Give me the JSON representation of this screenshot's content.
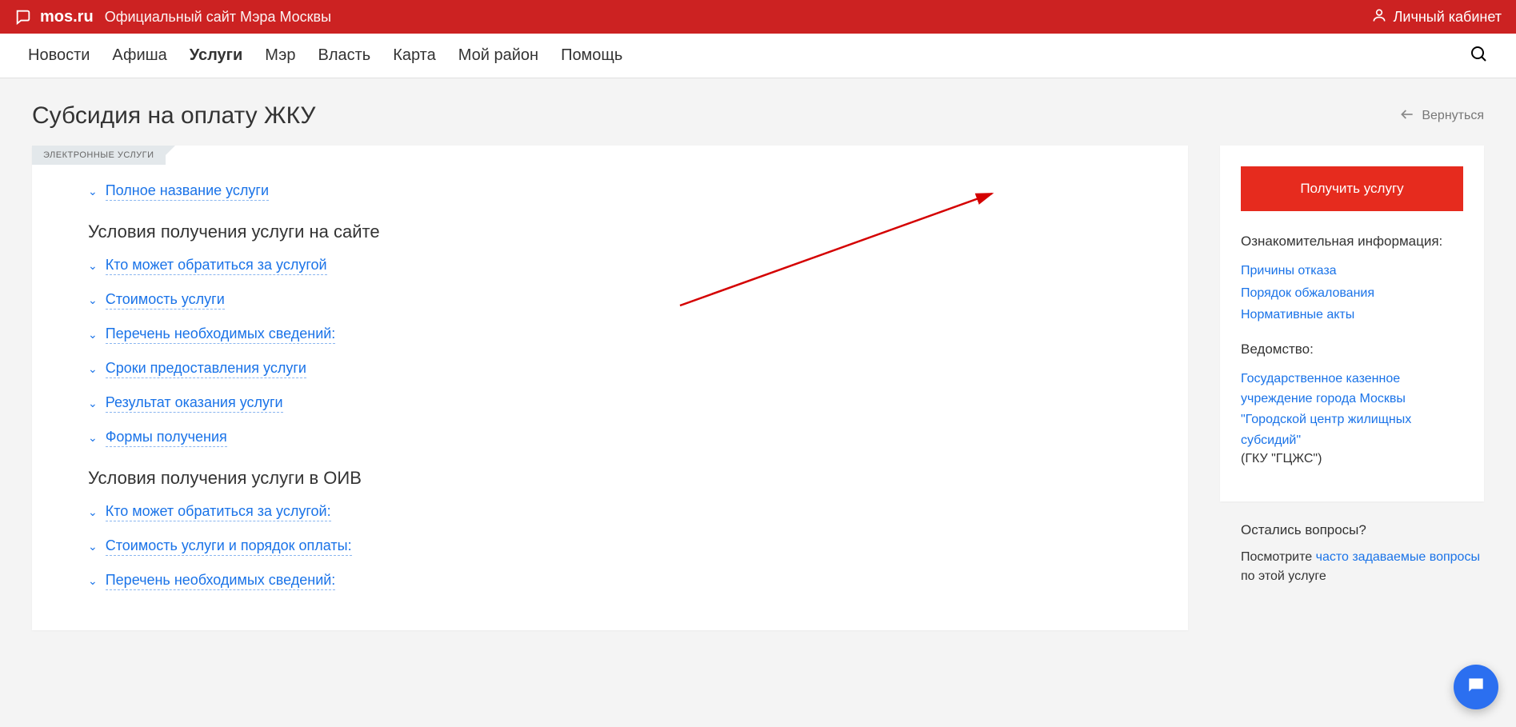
{
  "topbar": {
    "sitename": "mos.ru",
    "sitedesc": "Официальный сайт Мэра Москвы",
    "account": "Личный кабинет"
  },
  "nav": {
    "items": [
      "Новости",
      "Афиша",
      "Услуги",
      "Мэр",
      "Власть",
      "Карта",
      "Мой район",
      "Помощь"
    ],
    "active_index": 2
  },
  "page": {
    "title": "Субсидия на оплату ЖКУ",
    "back_label": "Вернуться",
    "tag": "ЭЛЕКТРОННЫЕ УСЛУГИ"
  },
  "main": {
    "top_link": "Полное название услуги",
    "section1_title": "Условия получения услуги на сайте",
    "section1_items": [
      "Кто может обратиться за услугой",
      "Стоимость услуги",
      "Перечень необходимых сведений:",
      "Сроки предоставления услуги",
      "Результат оказания услуги",
      "Формы получения"
    ],
    "section2_title": "Условия получения услуги в ОИВ",
    "section2_items": [
      "Кто может обратиться за услугой:",
      "Стоимость услуги и порядок оплаты:",
      "Перечень необходимых сведений:"
    ]
  },
  "side": {
    "primary_button": "Получить услугу",
    "info_heading": "Ознакомительная информация:",
    "info_links": [
      "Причины отказа",
      "Порядок обжалования",
      "Нормативные акты"
    ],
    "agency_heading": "Ведомство:",
    "agency_link": "Государственное казенное учреждение города Москвы \"Городской центр жилищных субсидий\"",
    "agency_plain": "(ГКУ \"ГЦЖС\")",
    "questions_heading": "Остались вопросы?",
    "questions_text_prefix": "Посмотрите ",
    "questions_link": "часто задаваемые вопросы",
    "questions_text_suffix": " по этой услуге"
  }
}
